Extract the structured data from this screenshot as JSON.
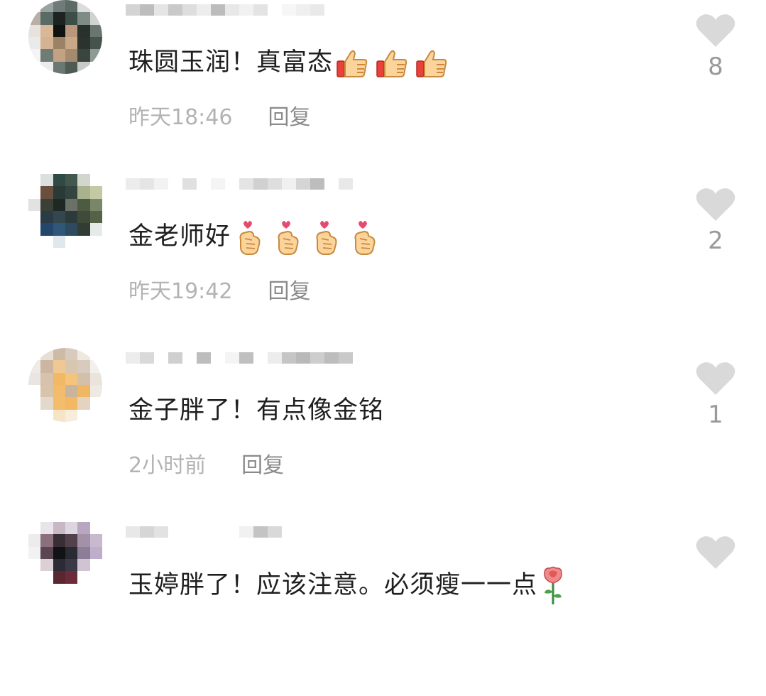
{
  "colors": {
    "text": "#1f1f1f",
    "meta": "#b3b3b3",
    "reply": "#8a8a8a",
    "heart": "#d9d9d9",
    "count": "#9a9a9a"
  },
  "comments": [
    {
      "text": "珠圆玉润！真富态",
      "emoji": [
        "thumbs-up-icon",
        "thumbs-up-icon",
        "thumbs-up-icon"
      ],
      "time": "昨天18:46",
      "reply_label": "回复",
      "like_count": "8"
    },
    {
      "text": "金老师好",
      "emoji": [
        "finger-heart-icon",
        "finger-heart-icon",
        "finger-heart-icon",
        "finger-heart-icon"
      ],
      "time": "昨天19:42",
      "reply_label": "回复",
      "like_count": "2"
    },
    {
      "text": "金子胖了！有点像金铭",
      "emoji": [],
      "time": "2小时前",
      "reply_label": "回复",
      "like_count": "1"
    },
    {
      "text": "玉婷胖了！应该注意。必须瘦一一点",
      "emoji": [
        "rose-icon"
      ],
      "time": "",
      "reply_label": "",
      "like_count": ""
    }
  ]
}
